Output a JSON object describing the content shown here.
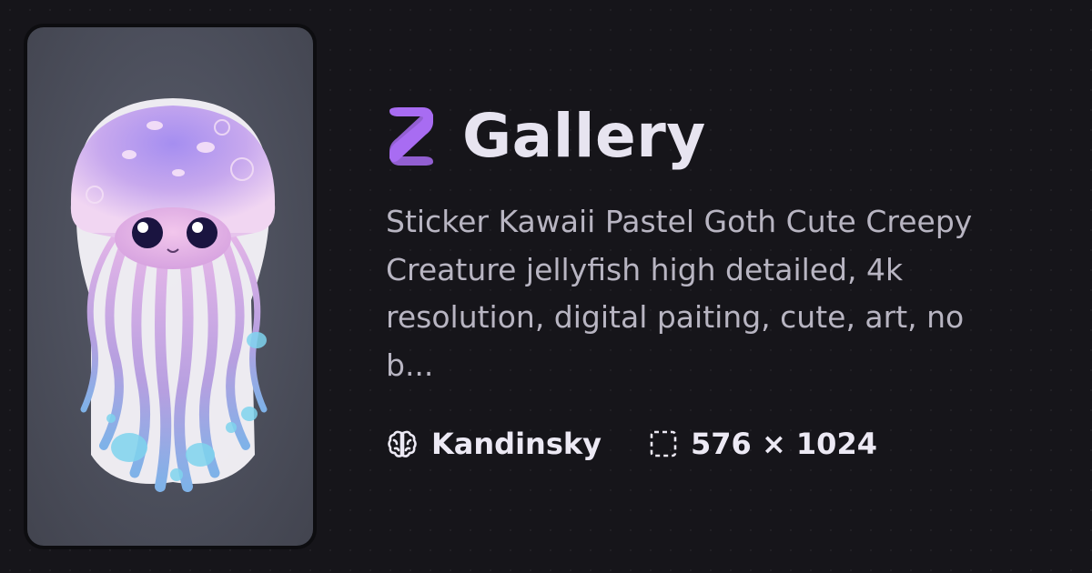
{
  "header": {
    "title": "Gallery",
    "logo_icon": "gallery-logo-icon",
    "accent_color": "#a86cf2"
  },
  "post": {
    "description": "Sticker Kawaii Pastel Goth Cute Creepy Creature jellyfish high detailed, 4k resolution, digital paiting, cute, art, no b...",
    "image_alt": "jellyfish",
    "model": {
      "icon": "brain-icon",
      "label": "Kandinsky"
    },
    "size": {
      "icon": "dashed-frame-icon",
      "label": "576 × 1024"
    }
  }
}
